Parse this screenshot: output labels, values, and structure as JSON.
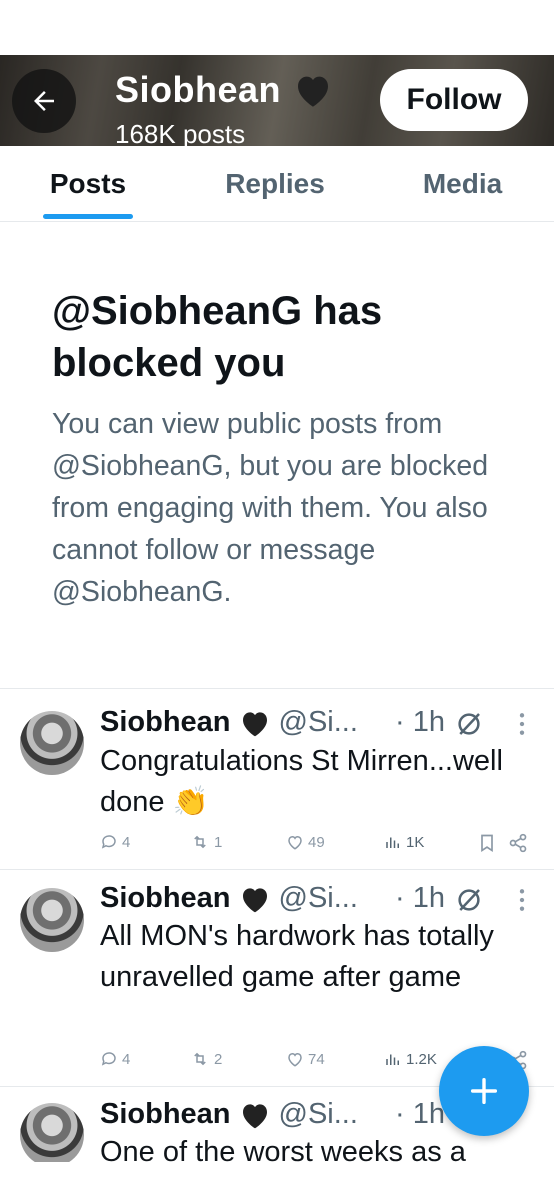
{
  "header": {
    "name": "Siobhean",
    "posts_count": "168K posts",
    "follow_label": "Follow"
  },
  "tabs": [
    {
      "label": "Posts",
      "active": true
    },
    {
      "label": "Replies",
      "active": false
    },
    {
      "label": "Media",
      "active": false
    }
  ],
  "blocked": {
    "title": "@SiobheanG has blocked you",
    "message": "You can view public posts from @SiobheanG, but you are blocked from engaging with them. You also cannot follow or message @SiobheanG."
  },
  "tweets": [
    {
      "name": "Siobhean",
      "handle": "@Si...",
      "time": "· 1h",
      "text": "Congratulations St Mirren...well done 👏",
      "replies": "4",
      "reposts": "1",
      "likes": "49",
      "views": "1K"
    },
    {
      "name": "Siobhean",
      "handle": "@Si...",
      "time": "· 1h",
      "text": "All MON's hardwork has totally unravelled game after game",
      "replies": "4",
      "reposts": "2",
      "likes": "74",
      "views": "1.2K"
    },
    {
      "name": "Siobhean",
      "handle": "@Si...",
      "time": "· 1h",
      "text": "One of the worst weeks as a"
    }
  ],
  "icons": {
    "back": "arrow-left-icon",
    "verified_heart": "black-heart-icon",
    "grok": "slash-circle-icon",
    "more": "more-vertical-icon",
    "reply": "reply-icon",
    "repost": "repost-icon",
    "like": "heart-outline-icon",
    "views": "views-icon",
    "bookmark": "bookmark-icon",
    "share": "share-icon",
    "compose": "plus-icon"
  },
  "colors": {
    "accent": "#1d9bf0",
    "text_primary": "#0f1419",
    "text_secondary": "#536471"
  }
}
